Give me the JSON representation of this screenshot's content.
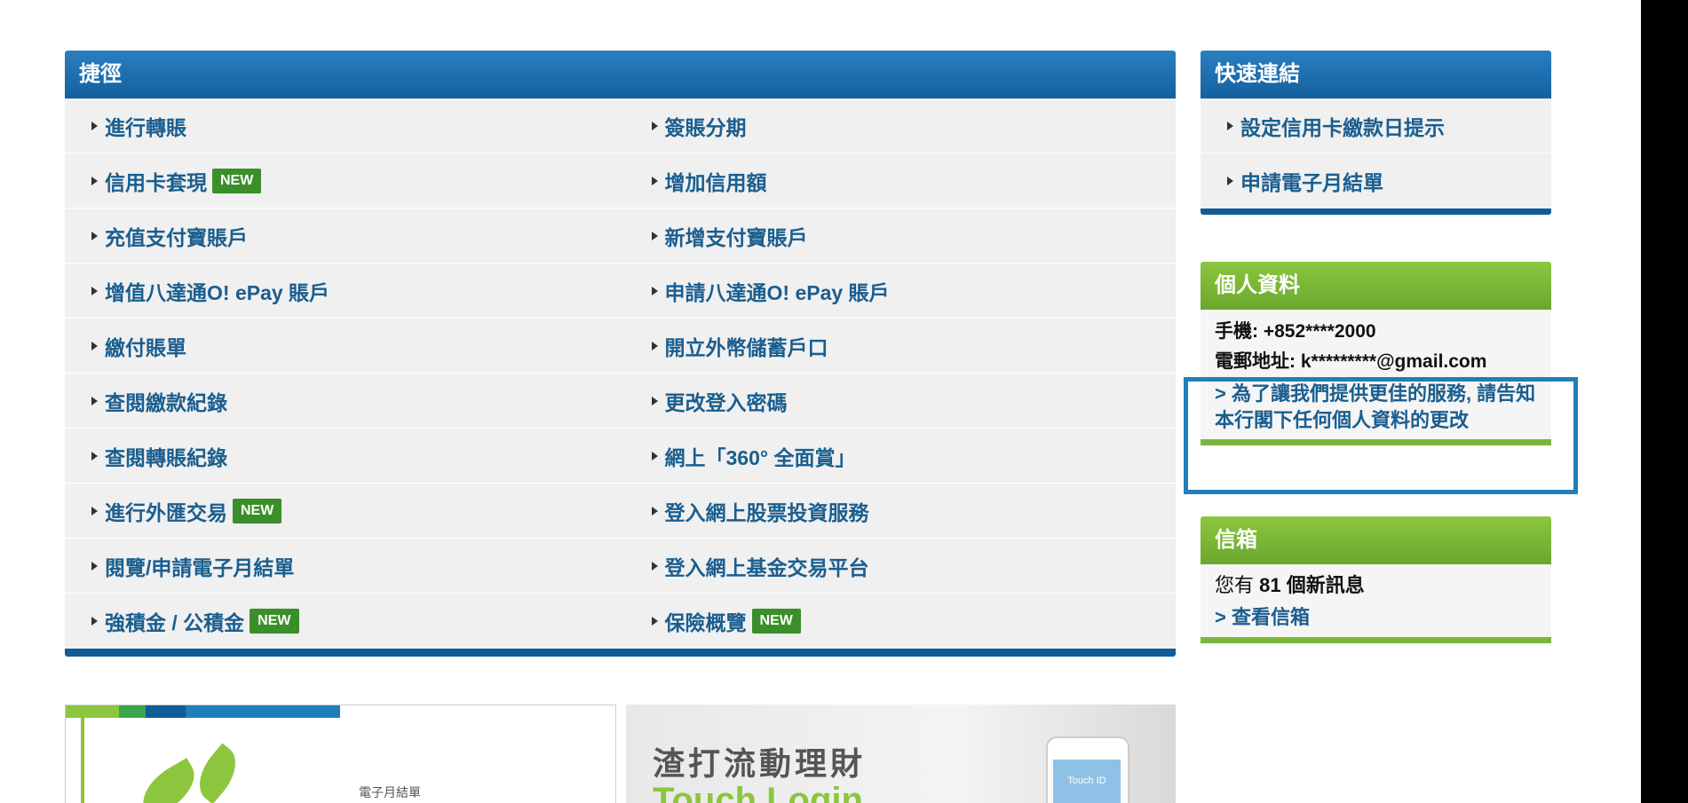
{
  "shortcuts": {
    "title": "捷徑",
    "rows": [
      {
        "left": {
          "label": "進行轉賬",
          "badge": ""
        },
        "right": {
          "label": "簽賬分期",
          "badge": ""
        }
      },
      {
        "left": {
          "label": "信用卡套現",
          "badge": "NEW"
        },
        "right": {
          "label": "增加信用額",
          "badge": ""
        }
      },
      {
        "left": {
          "label": "充值支付寶賬戶",
          "badge": ""
        },
        "right": {
          "label": "新增支付寶賬戶",
          "badge": ""
        }
      },
      {
        "left": {
          "label": "增值八達通O! ePay 賬戶",
          "badge": ""
        },
        "right": {
          "label": "申請八達通O! ePay 賬戶",
          "badge": ""
        }
      },
      {
        "left": {
          "label": "繳付賬單",
          "badge": ""
        },
        "right": {
          "label": "開立外幣儲蓄戶口",
          "badge": ""
        }
      },
      {
        "left": {
          "label": "查閱繳款紀錄",
          "badge": ""
        },
        "right": {
          "label": "更改登入密碼",
          "badge": ""
        }
      },
      {
        "left": {
          "label": "查閱轉賬紀錄",
          "badge": ""
        },
        "right": {
          "label": "網上「360° 全面賞」",
          "badge": ""
        }
      },
      {
        "left": {
          "label": "進行外匯交易",
          "badge": "NEW"
        },
        "right": {
          "label": "登入網上股票投資服務",
          "badge": ""
        }
      },
      {
        "left": {
          "label": "閱覽/申請電子月結單",
          "badge": ""
        },
        "right": {
          "label": "登入網上基金交易平台",
          "badge": ""
        }
      },
      {
        "left": {
          "label": "強積金 / 公積金",
          "badge": "NEW"
        },
        "right": {
          "label": "保險概覽",
          "badge": "NEW"
        }
      }
    ]
  },
  "quick_links": {
    "title": "快速連結",
    "items": [
      "設定信用卡繳款日提示",
      "申請電子月結單"
    ]
  },
  "profile": {
    "title": "個人資料",
    "mobile_label": "手機:",
    "mobile_value": "+852****2000",
    "email_label": "電郵地址:",
    "email_value": "k*********@gmail.com",
    "update_link": "> 為了讓我們提供更佳的服務, 請告知本行閣下任何個人資料的更改"
  },
  "inbox": {
    "title": "信箱",
    "prefix": "您有",
    "count": "81",
    "suffix": "個新訊息",
    "link": "> 查看信箱"
  },
  "banners": {
    "estatement_label": "電子月結單",
    "mobile_title": "渣打流動理財",
    "mobile_sub": "Touch Login",
    "phone_text": "Touch ID"
  },
  "colors": {
    "blue_header": "#13609f",
    "green_header": "#78b83a",
    "new_badge": "#3a8f2a",
    "link": "#1a5e8f",
    "highlight_border": "#1f7fb8"
  }
}
